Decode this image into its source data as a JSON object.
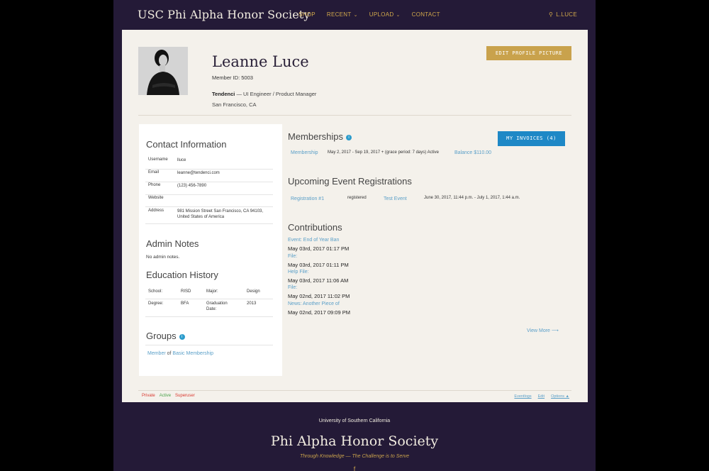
{
  "nav": {
    "brand": "USC Phi Alpha Honor Society",
    "links": [
      {
        "label": "SHOP",
        "has_dropdown": false
      },
      {
        "label": "RECENT",
        "has_dropdown": true
      },
      {
        "label": "UPLOAD",
        "has_dropdown": true
      },
      {
        "label": "CONTACT",
        "has_dropdown": false
      }
    ],
    "user": "L.LUCE",
    "user_icon": "user-icon",
    "chevron_glyph": "⌄",
    "user_glyph": "⚲"
  },
  "profile": {
    "name": "Leanne Luce",
    "member_id": "Member ID: 5003",
    "company": "Tendenci",
    "title": " — UI Engineer / Product Manager",
    "location": "San Francisco, CA",
    "edit_button": "EDIT PROFILE PICTURE"
  },
  "contact": {
    "title": "Contact Information",
    "rows": [
      {
        "key": "Username",
        "value": "lluce"
      },
      {
        "key": "Email",
        "value": "leanne@tendenci.com"
      },
      {
        "key": "Phone",
        "value": "(123) 456-7890"
      },
      {
        "key": "Website",
        "value": ""
      },
      {
        "key": "Address",
        "value": "981 Mission Street San Francisco, CA 94103, United States of America"
      }
    ]
  },
  "admin_notes": {
    "title": "Admin Notes",
    "text": "No admin notes."
  },
  "education": {
    "title": "Education History",
    "rows": [
      [
        "School:",
        "RISD",
        "Major:",
        "Design"
      ],
      [
        "Degree:",
        "BFA",
        "Graduation Date:",
        "2013"
      ]
    ]
  },
  "groups": {
    "title": "Groups",
    "member_prefix": "Member",
    "of_text": " of ",
    "group_name": "Basic Membership"
  },
  "memberships": {
    "title": "Memberships",
    "link": "Membership",
    "period": "May 2, 2017 - Sep 19, 2017 + (grace period: 7 days) Active",
    "balance": "Balance $110.00",
    "invoices_button": "MY INVOICES (4)"
  },
  "events": {
    "title": "Upcoming Event Registrations",
    "registration": "Registration #1",
    "status": "registered",
    "event": "Test Event",
    "time": "June 30, 2017, 11:44 p.m. - July 1, 2017, 1:44 a.m."
  },
  "contributions": {
    "title": "Contributions",
    "items": [
      {
        "label": "Event: End of Year Ban",
        "date": "May 03rd, 2017 01:17 PM"
      },
      {
        "label": "File:",
        "date": "May 03rd, 2017 01:11 PM"
      },
      {
        "label": "Help File:",
        "date": "May 03rd, 2017 11:06 AM"
      },
      {
        "label": "File:",
        "date": "May 02nd, 2017 11:02 PM"
      },
      {
        "label": "News: Another Piece of",
        "date": "May 02nd, 2017 09:09 PM"
      }
    ],
    "view_more": "View More ⟶"
  },
  "status_footer": {
    "private": "Private",
    "active": "Active",
    "superuser": "Superuser",
    "links": [
      "Eventlogs",
      "Edit",
      "Options ▲"
    ],
    "colors": {
      "private": "#d9382f",
      "active": "#4aa24a",
      "superuser": "#d9382f"
    }
  },
  "site_footer": {
    "university": "University of Southern California",
    "title": "Phi Alpha Honor Society",
    "tagline": "Through Knowledge — The Challenge is to Serve",
    "social_glyph": "f"
  },
  "colors": {
    "background": "#241a37",
    "gold": "#c9a24c",
    "card": "#f4f1eb",
    "link": "#5a9fc8",
    "invoice_button": "#1e88c6"
  }
}
